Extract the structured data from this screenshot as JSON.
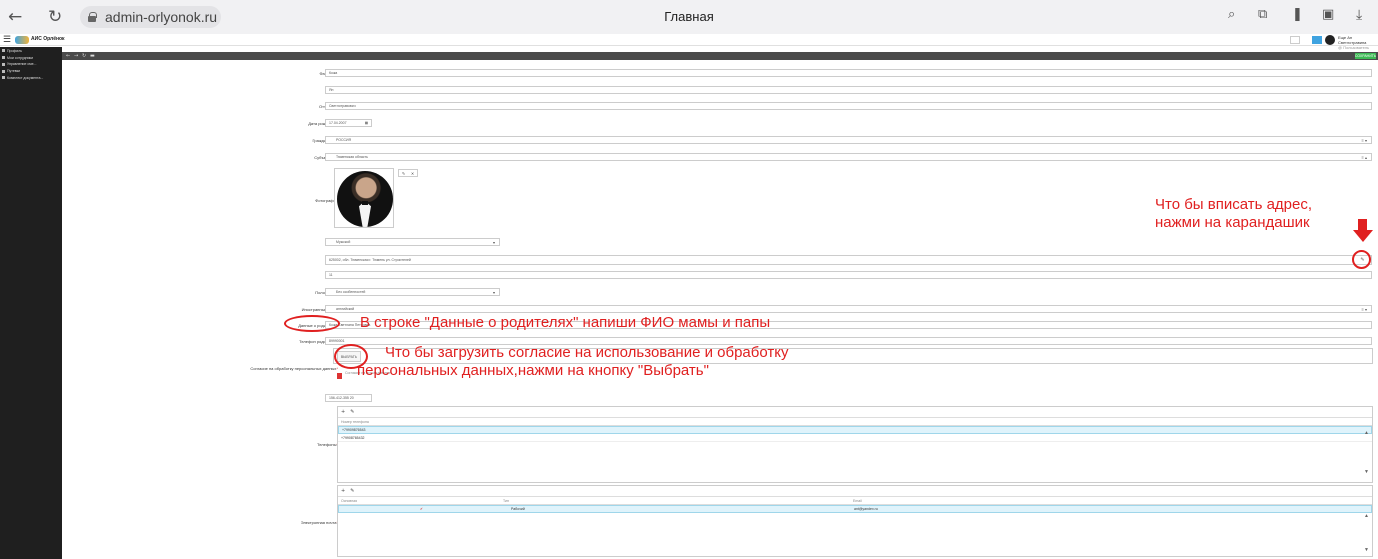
{
  "browser": {
    "url": "admin-orlyonok.ru",
    "tab_title": "Главная",
    "back_icon": "arrow-left-icon",
    "reload_icon": "reload-icon"
  },
  "app": {
    "name": "АИС Орлёнок",
    "user_name": "Еще Ан Светлотравина",
    "user_role": "@ Пользователь"
  },
  "sidebar": {
    "items": [
      {
        "label": "Профиль",
        "icon": "user-icon"
      },
      {
        "label": "Мои сотрудники",
        "icon": "users-icon"
      },
      {
        "label": "Управление сме...",
        "icon": "clock-icon"
      },
      {
        "label": "Путевки",
        "icon": "ticket-icon"
      },
      {
        "label": "Комплект документа...",
        "icon": "docs-icon"
      }
    ]
  },
  "toolbar": {
    "save_label": "СОХРАНИТЬ"
  },
  "form": {
    "surname": {
      "label": "Фамилия",
      "value": "Кожа"
    },
    "name": {
      "label": "Имя",
      "value": "Ян"
    },
    "patronymic": {
      "label": "Отчество",
      "value": "Светлотравович"
    },
    "birth_date": {
      "label": "Дата рождения",
      "value": "17.04.2007"
    },
    "citizenship": {
      "label": "Гражданство",
      "value": "РОССИЯ"
    },
    "region": {
      "label": "Субъект РФ",
      "value": "Тюменская область"
    },
    "photo": {
      "label": "Фотография"
    },
    "gender": {
      "label": "Пол",
      "value": "Мужской"
    },
    "address": {
      "label": "Адрес",
      "value": "625002, обл. Тюменская г. Тюмень ул. Строителей"
    },
    "grade": {
      "label": "Класс",
      "value": "11"
    },
    "disability": {
      "label": "Положение",
      "value": "Без особенностей"
    },
    "language": {
      "label": "Иностранный язык",
      "value": "английский"
    },
    "parents": {
      "label": "Данные о родителях",
      "value": "Кожа Светлана Петровна"
    },
    "parent_phone": {
      "label": "Телефон родителей",
      "value": "89990001"
    },
    "consent": {
      "label": "Согласие на обработку персональных данных",
      "button": "ВЫБРАТЬ",
      "note": "Согласие на использование"
    },
    "snils": {
      "label": "Снилс",
      "value": "156-412-355 20"
    },
    "phones": {
      "label": "Телефоны",
      "column": "Номер телефона",
      "rows": [
        "+79909876543",
        "+79908765432"
      ]
    },
    "emails": {
      "label": "Электронная почта",
      "columns": [
        "Основная",
        "Тип",
        "Email"
      ],
      "rows": [
        {
          "main": "✔",
          "type": "Рабочий",
          "email": "ant@yandex.ru"
        }
      ]
    }
  },
  "annotations": {
    "address_hint_line1": "Что бы вписать адрес,",
    "address_hint_line2": "нажми на карандашик",
    "parents_hint": "В строке \"Данные о родителях\" напиши ФИО мамы и папы",
    "consent_hint_line1": "Что бы загрузить согласие на использование и обработку",
    "consent_hint_line2": "персональных данных,нажми на кнопку \"Выбрать\"",
    "accent_color": "#e02020"
  }
}
